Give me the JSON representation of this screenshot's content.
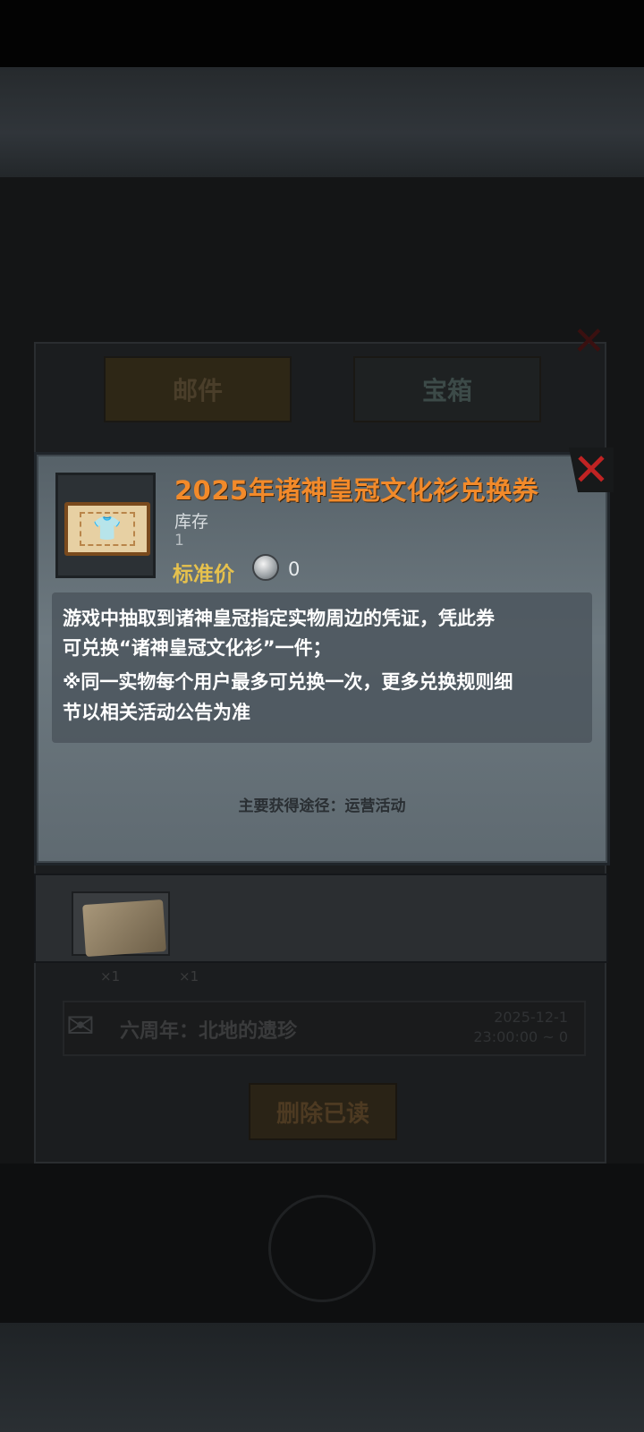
{
  "background": {
    "title": "",
    "tabs": [
      "邮件",
      "宝箱"
    ],
    "mail_row": {
      "title": "六周年：北地的遗珍",
      "date_line1": "2025-12-1",
      "date_line2": "23:00:00 ~ 0"
    },
    "attachment_counts": [
      "×1",
      "×1"
    ],
    "delete_read_label": "删除已读"
  },
  "dialog": {
    "item_name": "2025年诸神皇冠文化衫兑换券",
    "stock_label": "库存",
    "stock_value": "1",
    "price_label": "标准价",
    "price_value": "0",
    "description_lines": [
      "游戏中抽取到诸神皇冠指定实物周边的凭证，凭此券",
      "可兑换“诸神皇冠文化衫”一件；",
      "※同一实物每个用户最多可兑换一次，更多兑换规则细",
      "节以相关活动公告为准"
    ],
    "source_text": "主要获得途径：运营活动",
    "close_icon": "close-x-icon",
    "item_icon": "tshirt-ticket-icon",
    "currency_icon": "silver-coin-icon"
  },
  "colors": {
    "title_orange": "#f28a2a",
    "price_gold": "#e6c14d",
    "close_red": "#c02323"
  }
}
